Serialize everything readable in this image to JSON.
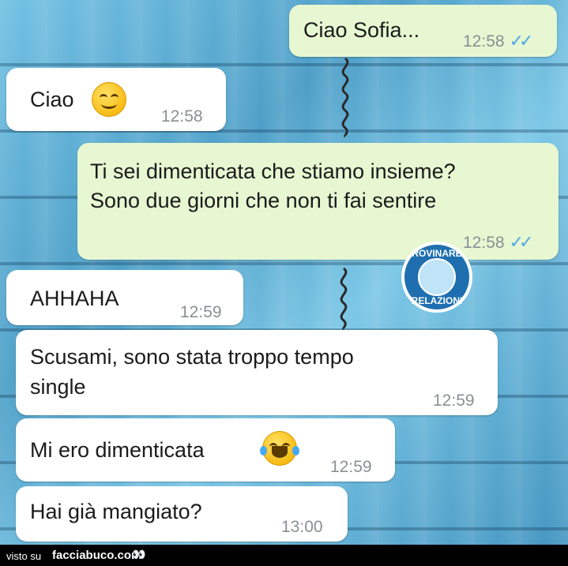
{
  "messages": [
    {
      "text": "Ciao Sofia...",
      "time": "12:58",
      "ticks": "✓✓"
    },
    {
      "text": "Ciao",
      "time": "12:58",
      "emoji": "smiling-face-icon"
    },
    {
      "line1": "Ti sei dimenticata che stiamo insieme?",
      "line2": "Sono due giorni che non ti fai sentire",
      "time": "12:58",
      "ticks": "✓✓"
    },
    {
      "text": "AHHAHA",
      "time": "12:59"
    },
    {
      "line1": "Scusami, sono stata troppo tempo",
      "line2": "single",
      "time": "12:59"
    },
    {
      "text": "Mi ero dimenticata",
      "time": "12:59",
      "emoji": "tears-of-joy-icon"
    },
    {
      "text": "Hai già mangiato?",
      "time": "13:00"
    }
  ],
  "watermark": {
    "top": "ROVINARE",
    "bottom": "RELAZIONI"
  },
  "footer": {
    "visto": "visto su",
    "site": "facciabuco.com",
    "eyes": "👀"
  },
  "colors": {
    "incoming": "#ffffff",
    "outgoing": "#e6f7d2",
    "ticks": "#53a8e6",
    "background": "#57a9cf"
  }
}
